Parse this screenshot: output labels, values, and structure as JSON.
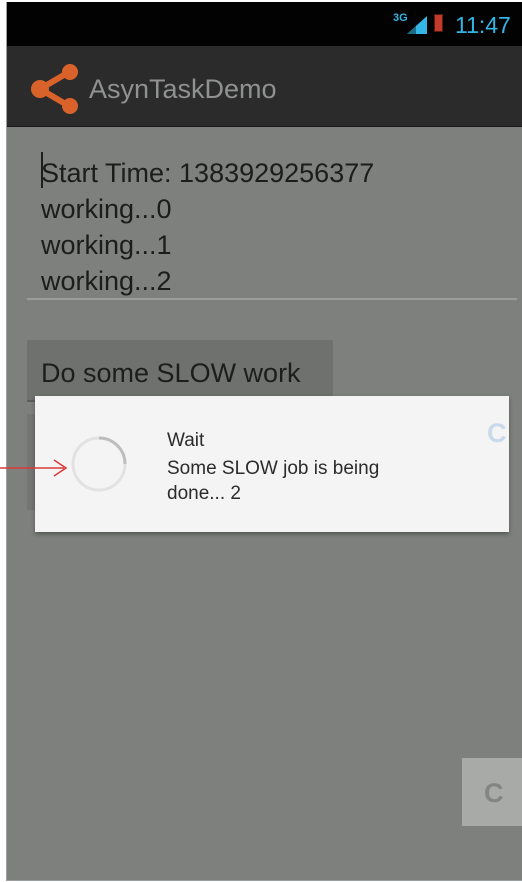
{
  "status_bar": {
    "network_label": "3G",
    "time": "11:47",
    "accent_color": "#33b5e5",
    "icons": [
      "signal-icon",
      "battery-icon"
    ]
  },
  "action_bar": {
    "icon": "share-icon",
    "icon_color": "#d9622b",
    "title": "AsynTaskDemo"
  },
  "output": {
    "lines": [
      "Start Time: 1383929256377",
      "working...0",
      "working...1",
      "working...2"
    ]
  },
  "button": {
    "label": "Do some SLOW work"
  },
  "dialog": {
    "title": "Wait",
    "message": "Some SLOW job is being done... 2",
    "icon": "spinner-icon",
    "truncated_fragment": "C"
  },
  "background_fragment": {
    "text": "C"
  },
  "annotation": {
    "icon": "arrow-icon",
    "color": "#d93a3a"
  }
}
